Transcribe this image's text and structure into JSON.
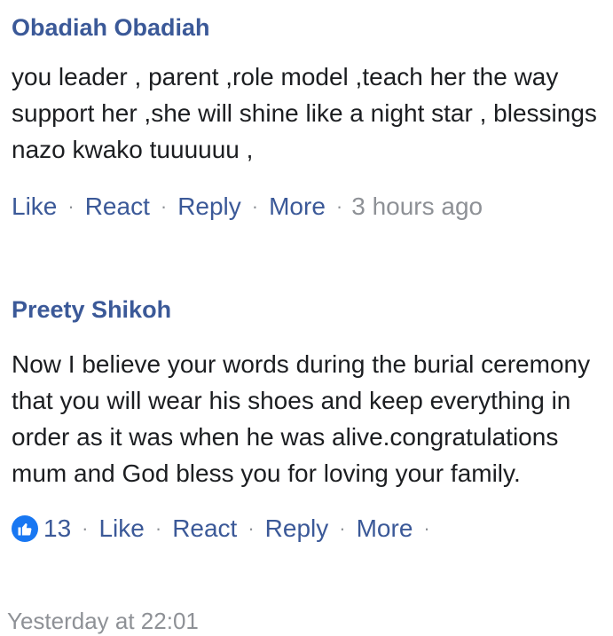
{
  "comments": [
    {
      "author": "Obadiah Obadiah",
      "text": "you leader , parent ,role model ,teach her the way support her ,she will shine like a night star , blessings nazo kwako tuuuuuu ,",
      "actions": {
        "like": "Like",
        "react": "React",
        "reply": "Reply",
        "more": "More"
      },
      "timestamp": "3 hours ago"
    },
    {
      "author": "Preety Shikoh",
      "text": "Now I believe your words during the burial ceremony that you will wear his shoes and keep everything in order as it was when he was alive.congratulations mum and God bless you for loving your family.",
      "reaction_count": "13",
      "actions": {
        "like": "Like",
        "react": "React",
        "reply": "Reply",
        "more": "More"
      },
      "timestamp": "Yesterday at 22:01"
    }
  ],
  "separator": "·",
  "colors": {
    "author": "#3b5998",
    "link": "#3b5998",
    "meta": "#8e9196",
    "like_badge": "#1877f2",
    "text": "#1c1e21"
  },
  "icons": {
    "reaction": "thumbs-up-icon"
  }
}
